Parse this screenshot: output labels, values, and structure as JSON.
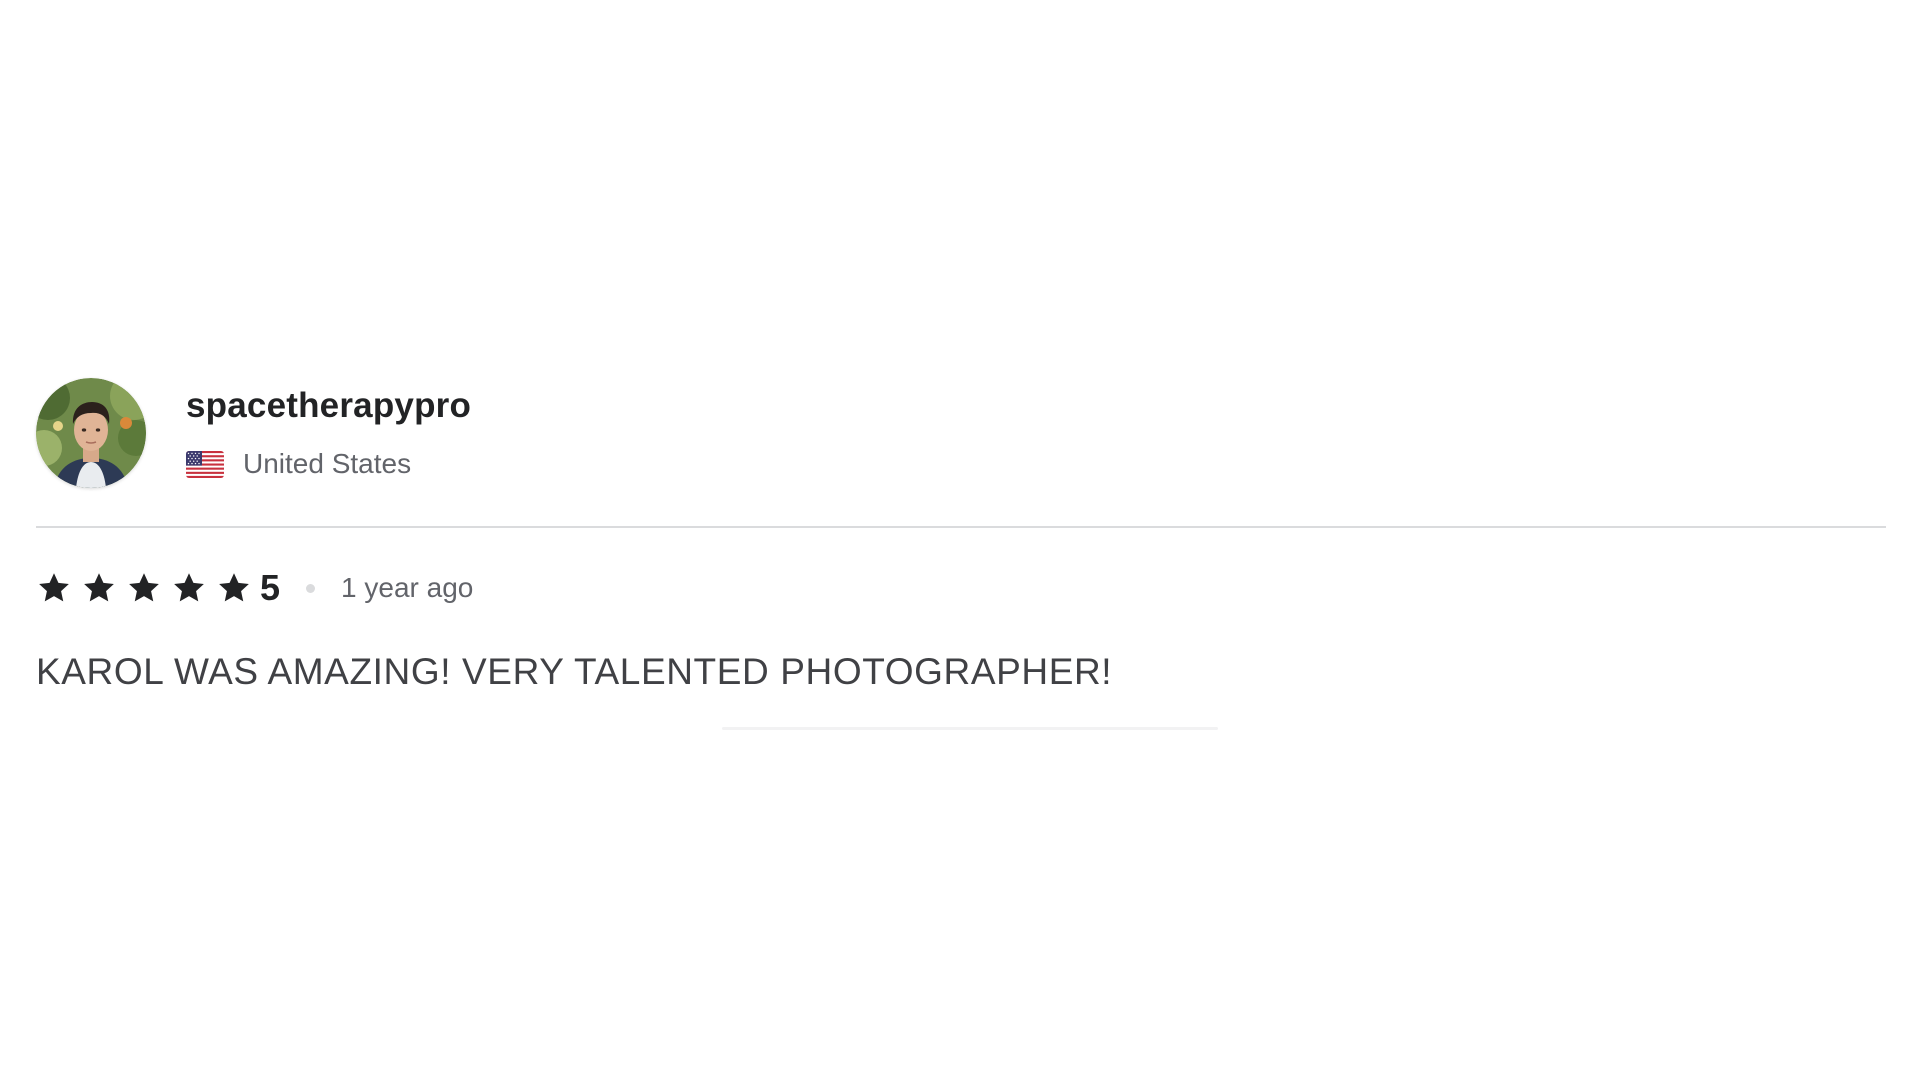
{
  "review": {
    "reviewer": {
      "username": "spacetherapypro",
      "country": "United States",
      "flag_icon": "us-flag-icon",
      "avatar_icon": "user-avatar"
    },
    "rating": {
      "value": "5",
      "stars_filled": 5,
      "stars_total": 5,
      "star_icon": "star-icon",
      "star_color": "#222325"
    },
    "time_ago": "1 year ago",
    "text": "KAROL WAS AMAZING! VERY TALENTED PHOTOGRAPHER!"
  },
  "colors": {
    "text_primary": "#222325",
    "text_secondary": "#62646a",
    "divider": "#dadbdd"
  }
}
